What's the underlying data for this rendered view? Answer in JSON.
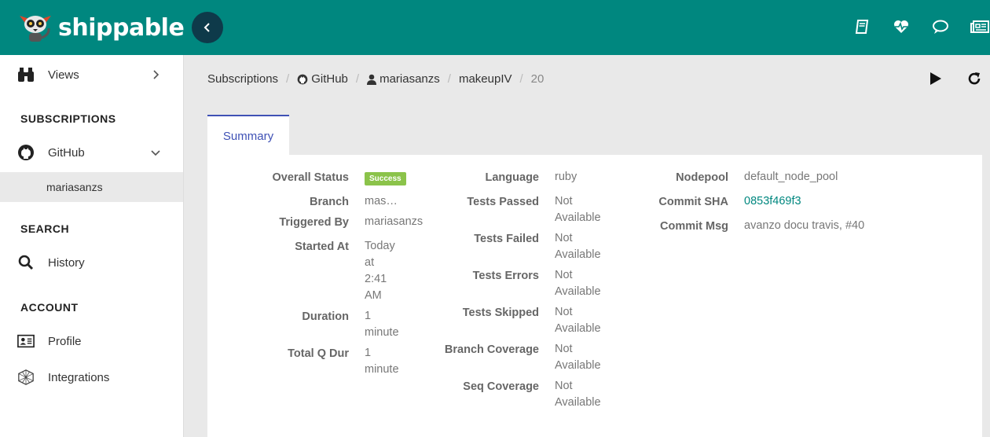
{
  "brand": {
    "name": "shippable"
  },
  "colors": {
    "topbar": "#00877f",
    "accent": "#3f51b5",
    "success": "#8bc34a",
    "link": "#00877f"
  },
  "topbar_icons": [
    "book-icon",
    "heartbeat-icon",
    "chat-icon",
    "newspaper-icon"
  ],
  "sidebar": {
    "views_label": "Views",
    "subscriptions_heading": "SUBSCRIPTIONS",
    "github_label": "GitHub",
    "account_item": "mariasanzs",
    "search_heading": "SEARCH",
    "history_label": "History",
    "account_heading": "ACCOUNT",
    "profile_label": "Profile",
    "integrations_label": "Integrations"
  },
  "breadcrumb": {
    "subscriptions": "Subscriptions",
    "github": "GitHub",
    "user": "mariasanzs",
    "repo": "makeupIV",
    "build": "20"
  },
  "tab": {
    "summary": "Summary"
  },
  "summary": {
    "overall_status_label": "Overall Status",
    "overall_status_value": "Success",
    "branch_label": "Branch",
    "branch_value": "mas…",
    "triggered_by_label": "Triggered By",
    "triggered_by_value": "mariasanzs",
    "started_at_label": "Started At",
    "started_at_lines": [
      "Today",
      "at",
      "2:41",
      "AM"
    ],
    "duration_label": "Duration",
    "duration_lines": [
      "1",
      "minute"
    ],
    "total_q_dur_label": "Total Q Dur",
    "total_q_dur_lines": [
      "1",
      "minute"
    ],
    "language_label": "Language",
    "language_value": "ruby",
    "tests_passed_label": "Tests Passed",
    "tests_failed_label": "Tests Failed",
    "tests_errors_label": "Tests Errors",
    "tests_skipped_label": "Tests Skipped",
    "branch_coverage_label": "Branch Coverage",
    "seq_coverage_label": "Seq Coverage",
    "not_available_lines": [
      "Not",
      "Available"
    ],
    "nodepool_label": "Nodepool",
    "nodepool_value": "default_node_pool",
    "commit_sha_label": "Commit SHA",
    "commit_sha_value": "0853f469f3",
    "commit_msg_label": "Commit Msg",
    "commit_msg_value": "avanzo docu travis, #40"
  }
}
